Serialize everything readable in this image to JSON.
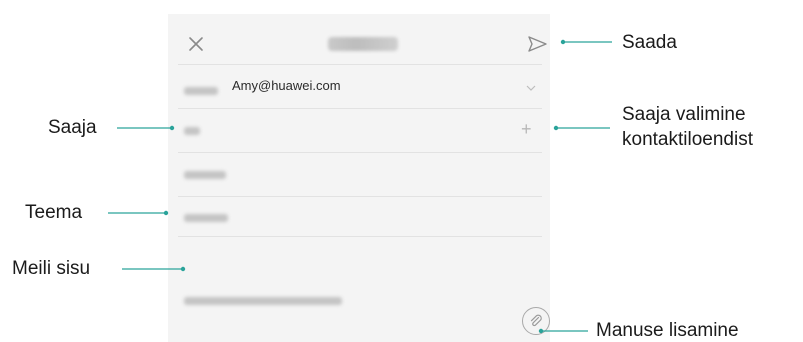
{
  "email": {
    "from_address": "Amy@huawei.com"
  },
  "callouts": {
    "send": "Saada",
    "recipient": "Saaja",
    "pick_contacts_line1": "Saaja valimine",
    "pick_contacts_line2": "kontaktiloendist",
    "subject": "Teema",
    "body": "Meili sisu",
    "attachment": "Manuse lisamine"
  },
  "icons": {
    "close": "close-icon",
    "send": "send-icon",
    "expand": "chevron-down-icon",
    "add_recipient": "plus-icon",
    "attach": "paperclip-icon"
  },
  "colors": {
    "panel_bg": "#f4f4f4",
    "callout_line": "#2aa39a",
    "icon": "#8a8a8a"
  }
}
